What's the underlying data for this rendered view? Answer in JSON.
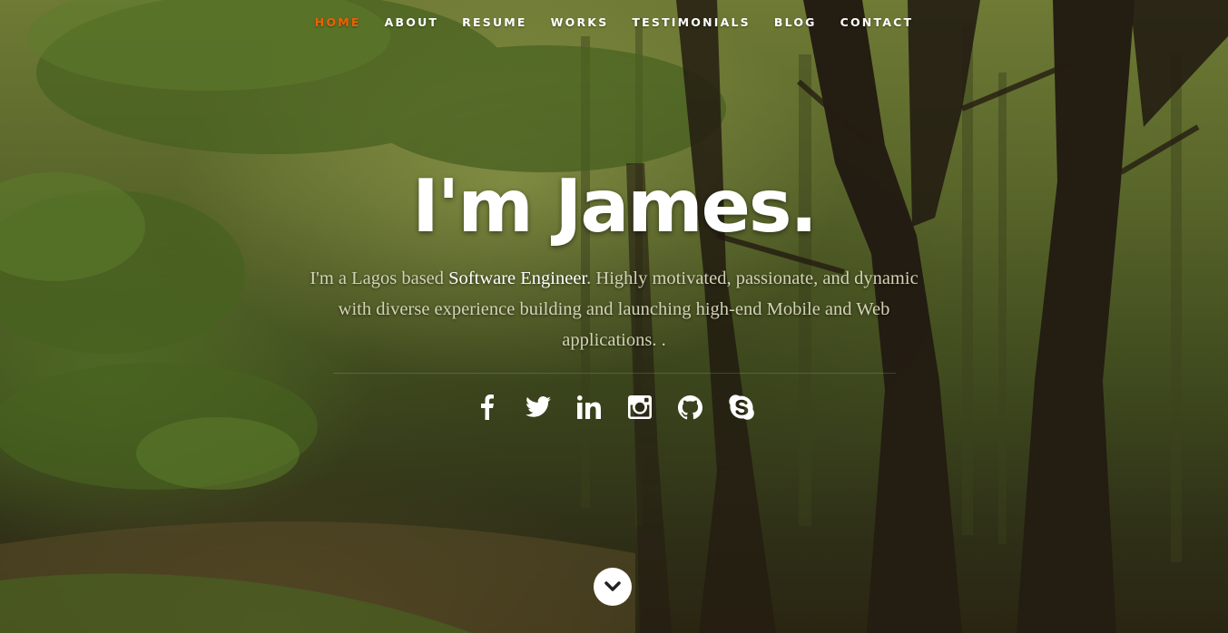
{
  "nav": {
    "items": [
      {
        "label": "HOME",
        "active": true
      },
      {
        "label": "ABOUT",
        "active": false
      },
      {
        "label": "RESUME",
        "active": false
      },
      {
        "label": "WORKS",
        "active": false
      },
      {
        "label": "TESTIMONIALS",
        "active": false
      },
      {
        "label": "BLOG",
        "active": false
      },
      {
        "label": "CONTACT",
        "active": false
      }
    ],
    "active_color": "#f06000"
  },
  "banner": {
    "headline": "I'm James.",
    "intro_before": "I'm a Lagos based ",
    "intro_highlight": "Software Engineer",
    "intro_after": ". Highly motivated, passionate, and dynamic with diverse experience building and launching high-end Mobile and Web applications. ."
  },
  "social": [
    {
      "name": "facebook-icon"
    },
    {
      "name": "twitter-icon"
    },
    {
      "name": "linkedin-icon"
    },
    {
      "name": "instagram-icon"
    },
    {
      "name": "github-icon"
    },
    {
      "name": "skype-icon"
    }
  ],
  "scroll_down": {
    "icon": "chevron-down-icon"
  }
}
